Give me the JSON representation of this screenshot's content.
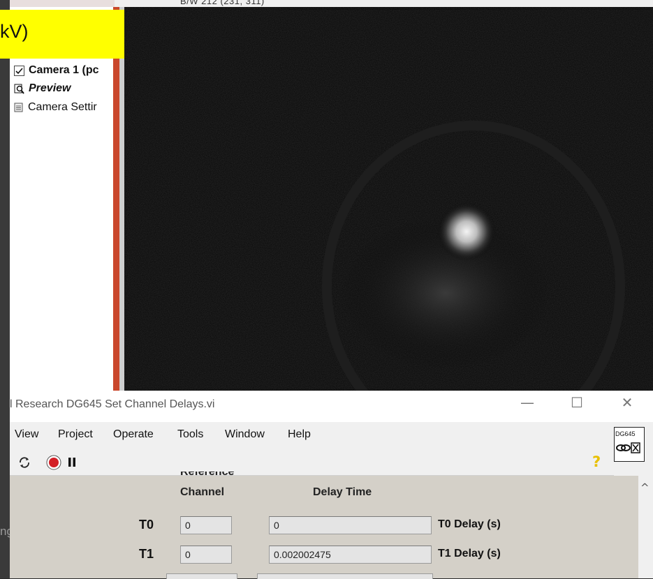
{
  "camera_window": {
    "status_text": "B/W    212 (231, 311)",
    "title_banner": "kV)",
    "tree_items": [
      {
        "label": "Camera 1 (pc",
        "icon": "checkbox-checked-icon"
      },
      {
        "label": "Preview",
        "icon": "preview-icon"
      },
      {
        "label": "Camera Settir",
        "icon": "settings-list-icon"
      }
    ]
  },
  "desktop": {
    "clipped_text": "ng"
  },
  "lv_window": {
    "title": "l Research DG645 Set Channel Delays.vi",
    "controls": {
      "minimize": "—",
      "maximize": "☐",
      "close": "✕"
    },
    "menu": [
      "View",
      "Project",
      "Operate",
      "Tools",
      "Window",
      "Help"
    ],
    "toolbar": {
      "help_glyph": "?"
    },
    "badge": "DG645",
    "panel": {
      "header_reference_partial": "Reference",
      "header_channel": "Channel",
      "header_delay_time": "Delay Time",
      "rows": [
        {
          "label": "T0",
          "reference": "0",
          "delay": "0",
          "delay_label": "T0 Delay (s)"
        },
        {
          "label": "T1",
          "reference": "0",
          "delay": "0.002002475",
          "delay_label": "T1 Delay (s)"
        }
      ]
    },
    "scroll_up": "^"
  },
  "colors": {
    "title_banner": "#ffff00",
    "tree_redline": "#c9472c",
    "panel_bg": "#d4d0c8"
  }
}
